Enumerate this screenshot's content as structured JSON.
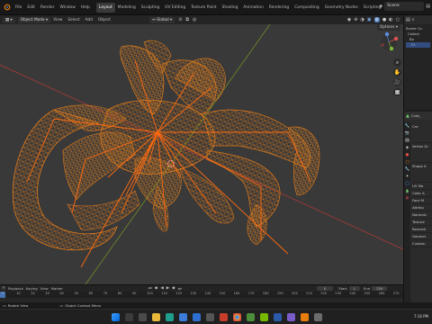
{
  "workspace_tabs": [
    "Layout",
    "Modeling",
    "Sculpting",
    "UV Editing",
    "Texture Paint",
    "Shading",
    "Animation",
    "Rendering",
    "Compositing",
    "Geometry Nodes",
    "Scripting"
  ],
  "active_tab": "Layout",
  "scene_name": "Scene",
  "header": {
    "mode": "Object Mode",
    "view": "View",
    "select": "Select",
    "add": "Add",
    "object": "Object",
    "orientation": "Global",
    "options": "Options"
  },
  "outliner": {
    "title": "Scene Collection",
    "rows": [
      "Scene Co",
      "Collect",
      "Bo",
      "Cr"
    ]
  },
  "properties": {
    "object_name": "Crab_",
    "sections": [
      "Cre",
      "Vertex Gr",
      "Shape K",
      "UV Ma",
      "Color A",
      "Face M",
      "Attribu",
      "Normals",
      "Texture",
      "Remesh",
      "Geomet",
      "Custom"
    ]
  },
  "timeline": {
    "playback": "Playback",
    "keying": "Keying",
    "view": "View",
    "marker": "Marker",
    "current_frame": "0",
    "start_label": "Start",
    "start": "1",
    "end_label": "End",
    "end": "250",
    "ticks": [
      "0",
      "10",
      "20",
      "30",
      "40",
      "50",
      "60",
      "70",
      "80",
      "90",
      "100",
      "110",
      "120",
      "130",
      "140",
      "150",
      "160",
      "170",
      "180",
      "190",
      "200",
      "210",
      "220",
      "230",
      "240",
      "250",
      "260",
      "270"
    ]
  },
  "status": {
    "left": "Rotate View",
    "middle": "Object Context Menu"
  },
  "taskbar": {
    "time": "7:16 PM"
  },
  "colors": {
    "wire": "#e07a1a",
    "bones": "#ff6b10",
    "x_axis": "#a83a3a",
    "y_axis": "#6f8f2a",
    "viewport_bg": "#393939"
  }
}
